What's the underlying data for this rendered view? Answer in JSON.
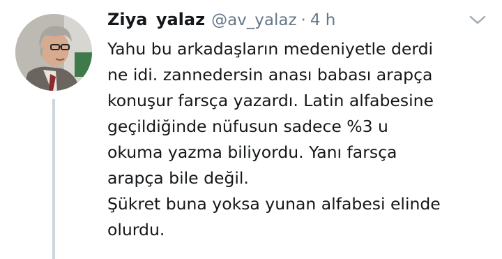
{
  "tweet": {
    "display_name": "Ziya  yalaz",
    "handle": "@av_yalaz",
    "separator": "·",
    "time": "4 h",
    "lines": [
      "Yahu bu arkadaşların medeniyetle derdi",
      "ne idi. zannedersin anası babası arapça",
      "konuşur farsça yazardı. Latin alfabesine",
      "geçildiğinde nüfusun sadece %3 u",
      "okuma yazma biliyordu. Yanı farsça",
      "arapça bile değil.",
      "Şükret buna yoksa yunan alfabesi elinde",
      "olurdu."
    ]
  },
  "icons": {
    "menu": "chevron-down-icon",
    "avatar": "profile-photo"
  },
  "colors": {
    "text_primary": "#14171a",
    "text_secondary": "#657786",
    "thread_line": "#ccd6dd",
    "background": "#ffffff"
  }
}
